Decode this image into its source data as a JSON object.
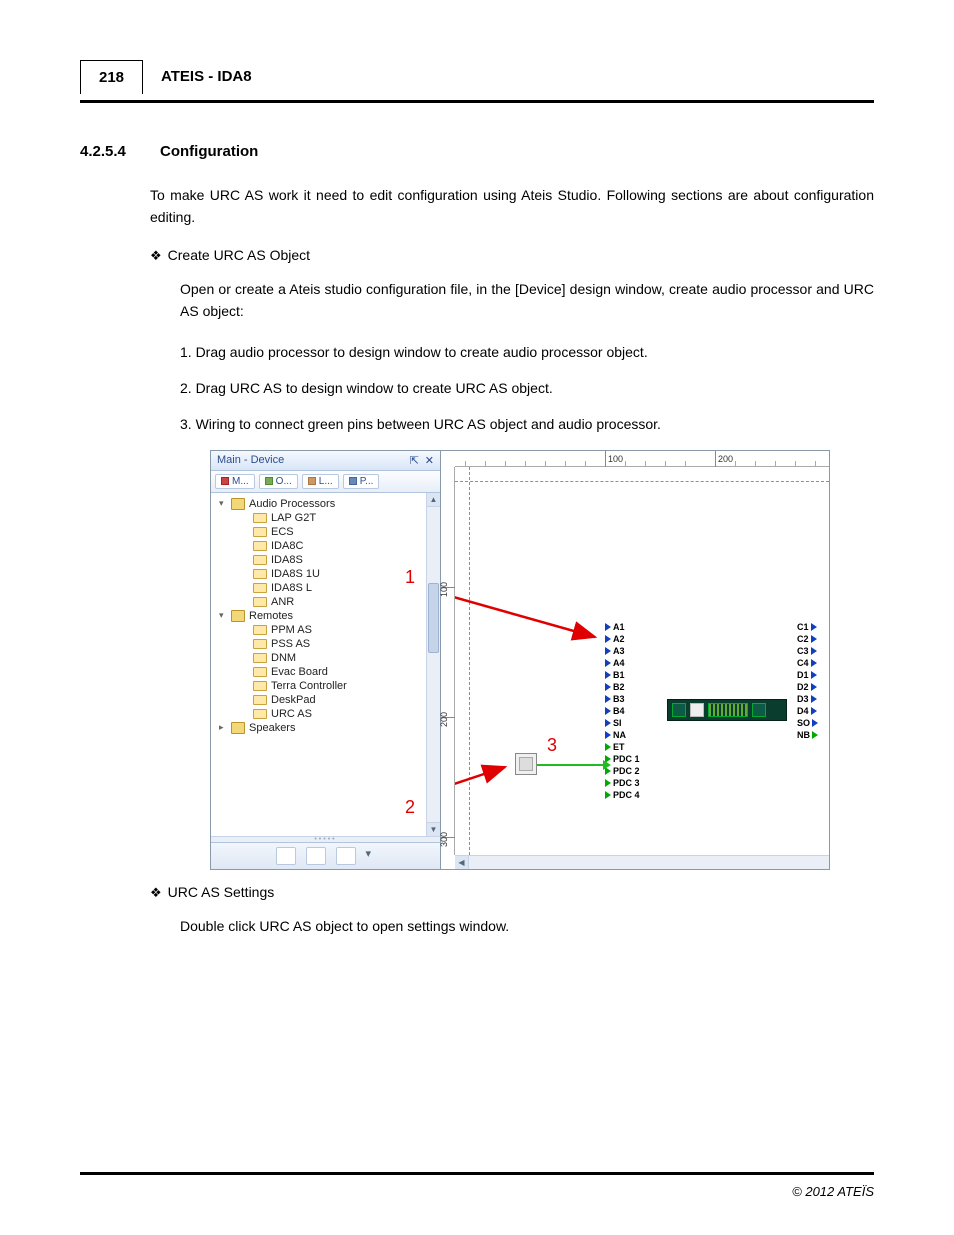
{
  "header": {
    "page_number": "218",
    "title": "ATEIS - IDA8"
  },
  "section": {
    "number": "4.2.5.4",
    "title": "Configuration"
  },
  "intro": "To make URC AS work it need to edit configuration using Ateis Studio. Following sections are about configuration editing.",
  "bullets": [
    {
      "title": "Create URC AS Object",
      "lead": "Open or create a Ateis studio configuration file, in the [Device] design window, create audio processor and URC AS object:",
      "steps": [
        "1. Drag audio processor to design window to create audio processor object.",
        "2. Drag URC AS to design window to create URC AS object.",
        "3. Wiring to connect green pins between URC AS object and audio processor."
      ]
    },
    {
      "title": "URC AS Settings",
      "lead": "Double click URC AS object to open settings window."
    }
  ],
  "screenshot": {
    "panel_title": "Main - Device",
    "tabs": [
      "M...",
      "O...",
      "L...",
      "P..."
    ],
    "tree": {
      "audio_processors": {
        "label": "Audio Processors",
        "items": [
          "LAP G2T",
          "ECS",
          "IDA8C",
          "IDA8S",
          "IDA8S 1U",
          "IDA8S L",
          "ANR"
        ]
      },
      "remotes": {
        "label": "Remotes",
        "items": [
          "PPM AS",
          "PSS AS",
          "DNM",
          "Evac Board",
          "Terra Controller",
          "DeskPad",
          "URC AS"
        ]
      },
      "speakers": {
        "label": "Speakers"
      }
    },
    "ruler_h": [
      "100",
      "200"
    ],
    "ruler_v": [
      "100",
      "200",
      "300"
    ],
    "device_pins_left": [
      "A1",
      "A2",
      "A3",
      "A4",
      "B1",
      "B2",
      "B3",
      "B4",
      "SI",
      "NA",
      "ET",
      "PDC 1",
      "PDC 2",
      "PDC 3",
      "PDC 4"
    ],
    "device_pins_right": [
      "C1",
      "C2",
      "C3",
      "C4",
      "D1",
      "D2",
      "D3",
      "D4",
      "SO",
      "NB"
    ],
    "annotations": {
      "n1": "1",
      "n2": "2",
      "n3": "3"
    }
  },
  "footer": "© 2012 ATEÏS"
}
